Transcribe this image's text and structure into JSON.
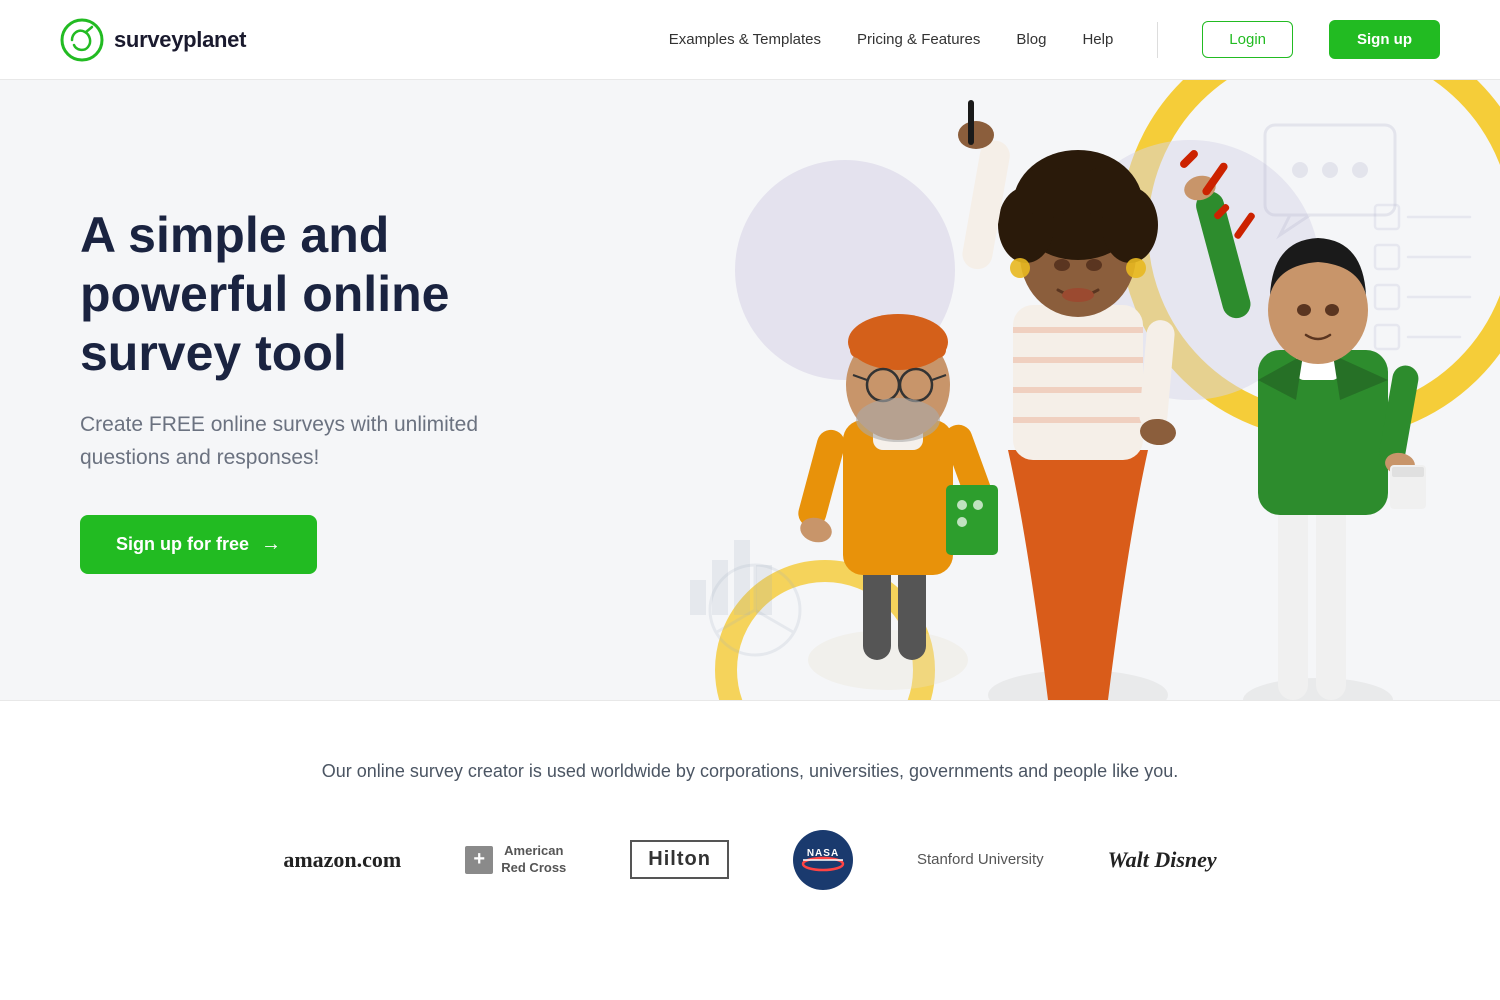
{
  "header": {
    "logo_text": "surveyplanet",
    "logo_tm": "®",
    "nav": {
      "examples": "Examples & Templates",
      "pricing": "Pricing & Features",
      "blog": "Blog",
      "help": "Help",
      "login": "Login",
      "signup": "Sign up"
    }
  },
  "hero": {
    "title": "A simple and powerful online survey tool",
    "subtitle": "Create FREE online surveys with unlimited questions and responses!",
    "cta": "Sign up for free",
    "cta_arrow": "→"
  },
  "trusted": {
    "headline": "Our online survey creator is used worldwide by corporations, universities, governments and people like you.",
    "brands": [
      {
        "id": "amazon",
        "name": "amazon.com"
      },
      {
        "id": "redcross",
        "name": "American Red Cross"
      },
      {
        "id": "hilton",
        "name": "Hilton"
      },
      {
        "id": "nasa",
        "name": "NASA"
      },
      {
        "id": "stanford",
        "name": "Stanford University"
      },
      {
        "id": "disney",
        "name": "Walt Disney"
      }
    ]
  }
}
